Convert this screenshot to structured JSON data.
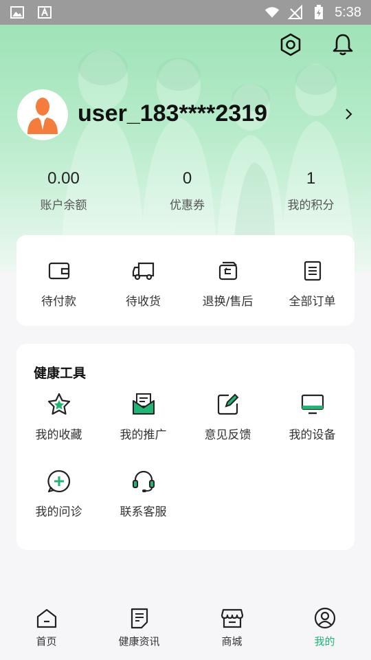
{
  "status_bar": {
    "time": "5:38"
  },
  "profile": {
    "username": "user_183****2319"
  },
  "stats": [
    {
      "value": "0.00",
      "label": "账户余额"
    },
    {
      "value": "0",
      "label": "优惠券"
    },
    {
      "value": "1",
      "label": "我的积分"
    }
  ],
  "orders": [
    {
      "label": "待付款",
      "icon": "wallet-icon"
    },
    {
      "label": "待收货",
      "icon": "truck-icon"
    },
    {
      "label": "退换/售后",
      "icon": "return-box-icon"
    },
    {
      "label": "全部订单",
      "icon": "order-list-icon"
    }
  ],
  "tools": {
    "title": "健康工具",
    "items": [
      {
        "label": "我的收藏",
        "icon": "star-icon"
      },
      {
        "label": "我的推广",
        "icon": "mail-icon"
      },
      {
        "label": "意见反馈",
        "icon": "edit-icon"
      },
      {
        "label": "我的设备",
        "icon": "monitor-icon"
      },
      {
        "label": "我的问诊",
        "icon": "plus-chat-icon"
      },
      {
        "label": "联系客服",
        "icon": "headset-icon"
      }
    ]
  },
  "nav": {
    "items": [
      {
        "label": "首页",
        "icon": "home-icon"
      },
      {
        "label": "健康资讯",
        "icon": "article-icon"
      },
      {
        "label": "商城",
        "icon": "store-icon"
      },
      {
        "label": "我的",
        "icon": "profile-icon"
      }
    ],
    "active_index": 3
  },
  "colors": {
    "accent": "#1fb674",
    "header_green": "#9fe3b8"
  }
}
